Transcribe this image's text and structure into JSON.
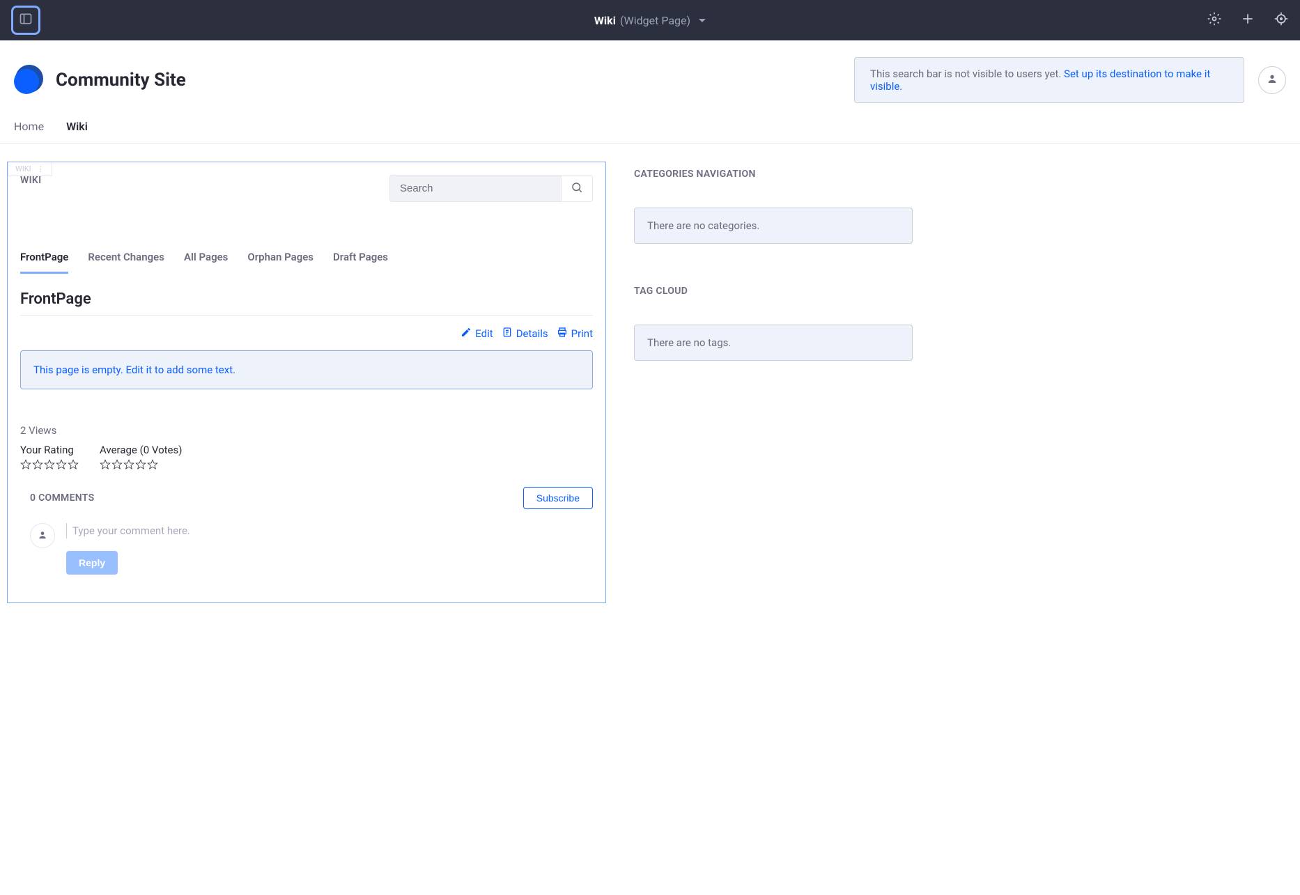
{
  "topbar": {
    "page_name": "Wiki",
    "page_type": "(Widget Page)"
  },
  "site": {
    "title": "Community Site",
    "search_notice_prefix": "This search bar is not visible to users yet. ",
    "search_notice_link": "Set up its destination to make it visible."
  },
  "nav": {
    "items": [
      {
        "label": "Home",
        "active": false
      },
      {
        "label": "Wiki",
        "active": true
      }
    ]
  },
  "wiki": {
    "portlet_label": "WIKI",
    "search_placeholder": "Search",
    "tabs": [
      {
        "label": "FrontPage",
        "active": true
      },
      {
        "label": "Recent Changes",
        "active": false
      },
      {
        "label": "All Pages",
        "active": false
      },
      {
        "label": "Orphan Pages",
        "active": false
      },
      {
        "label": "Draft Pages",
        "active": false
      }
    ],
    "page_title": "FrontPage",
    "actions": {
      "edit": "Edit",
      "details": "Details",
      "print": "Print"
    },
    "empty_message": "This page is empty. Edit it to add some text.",
    "views": "2 Views",
    "your_rating_label": "Your Rating",
    "average_label": "Average (0 Votes)",
    "comments_title": "0 COMMENTS",
    "subscribe_label": "Subscribe",
    "comment_placeholder": "Type your comment here.",
    "reply_label": "Reply"
  },
  "sidebar": {
    "categories_heading": "CATEGORIES NAVIGATION",
    "categories_empty": "There are no categories.",
    "tagcloud_heading": "TAG CLOUD",
    "tagcloud_empty": "There are no tags."
  }
}
